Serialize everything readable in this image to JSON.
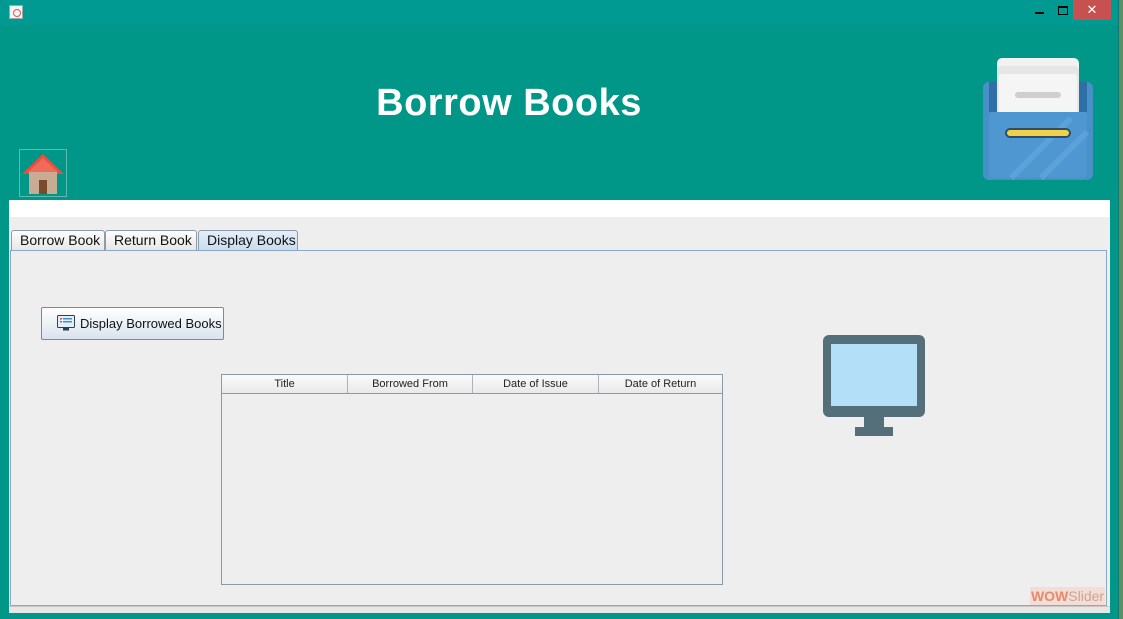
{
  "window": {
    "app_icon": "java-cup-icon",
    "controls": {
      "minimize": "minimize-icon",
      "maximize": "maximize-icon",
      "close": "✕"
    }
  },
  "header": {
    "title": "Borrow Books",
    "home_icon": "home-icon",
    "cabinet_icon": "file-cabinet-icon"
  },
  "tabs": [
    {
      "label": "Borrow Book",
      "active": false
    },
    {
      "label": "Return Book",
      "active": false
    },
    {
      "label": "Display Books",
      "active": true
    }
  ],
  "display_panel": {
    "button_label": "Display Borrowed Books",
    "button_icon": "monitor-list-icon",
    "table": {
      "columns": [
        "Title",
        "Borrowed From",
        "Date of Issue",
        "Date of Return"
      ],
      "rows": []
    },
    "illustration": "computer-monitor-icon"
  },
  "watermark": {
    "part1": "WOW",
    "part2": "Slider"
  },
  "colors": {
    "header_bg": "#009688",
    "tab_active": "#c9dcef",
    "close_button": "#c75050"
  }
}
